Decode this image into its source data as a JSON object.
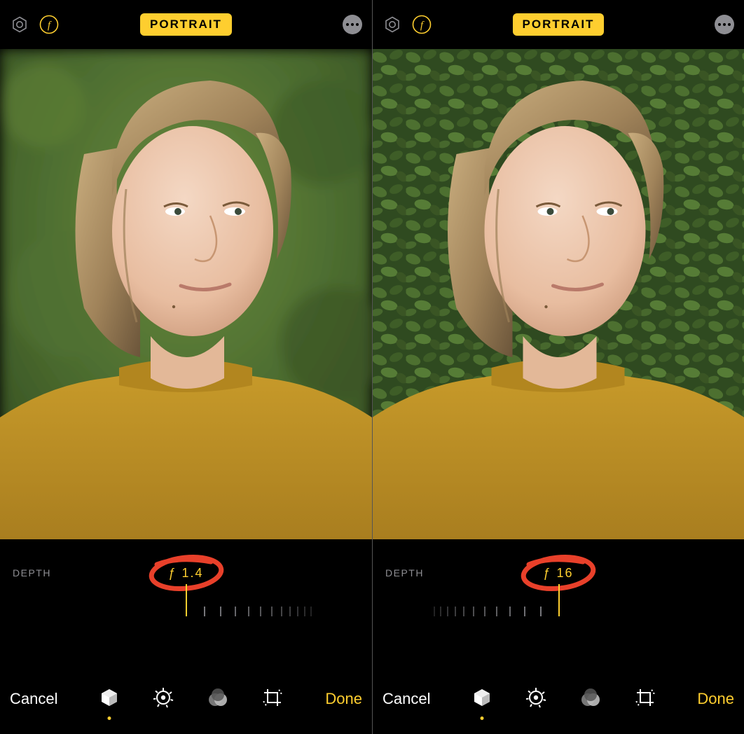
{
  "screens": [
    {
      "topbar": {
        "mode": "PORTRAIT"
      },
      "depth": {
        "label": "DEPTH",
        "fstop": "ƒ 1.4"
      },
      "slider": {
        "position": "left"
      },
      "toolbar": {
        "cancel": "Cancel",
        "done": "Done",
        "active_tool_index": 0
      },
      "photo": {
        "background_blur": 10
      }
    },
    {
      "topbar": {
        "mode": "PORTRAIT"
      },
      "depth": {
        "label": "DEPTH",
        "fstop": "ƒ 16"
      },
      "slider": {
        "position": "right"
      },
      "toolbar": {
        "cancel": "Cancel",
        "done": "Done",
        "active_tool_index": 0
      },
      "photo": {
        "background_blur": 0
      }
    }
  ],
  "icons": {
    "live": "live-photo-icon",
    "aperture": "aperture-icon",
    "more": "more-icon",
    "portrait_lighting": "lighting-cube-icon",
    "adjust": "adjust-dial-icon",
    "filters": "filters-venn-icon",
    "crop": "crop-rotate-icon"
  },
  "colors": {
    "accent": "#FECE2F",
    "muted": "#8E8E93",
    "annotation": "#E8402A"
  }
}
